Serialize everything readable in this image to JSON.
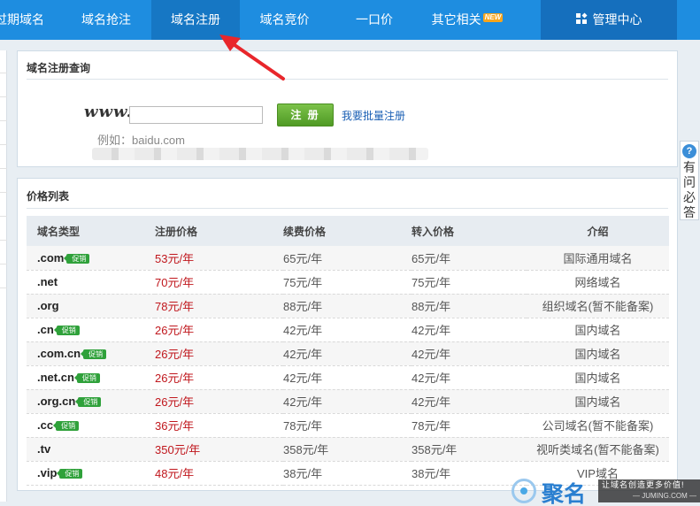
{
  "nav": {
    "items": [
      {
        "label": "过期域名"
      },
      {
        "label": "域名抢注"
      },
      {
        "label": "域名注册"
      },
      {
        "label": "域名竞价"
      },
      {
        "label": "一口价"
      },
      {
        "label": "其它相关",
        "badge": "NEW"
      }
    ],
    "management": "管理中心",
    "active_index": 2
  },
  "query": {
    "title": "域名注册查询",
    "www": "www.",
    "input_value": "",
    "register_button": "注 册",
    "batch_link": "我要批量注册",
    "example": "例如：baidu.com"
  },
  "price_list": {
    "title": "价格列表",
    "headers": [
      "域名类型",
      "注册价格",
      "续费价格",
      "转入价格",
      "介绍"
    ],
    "promo_label": "促销",
    "rows": [
      {
        "ext": ".com",
        "promo": true,
        "reg": "53元/年",
        "renew": "65元/年",
        "transfer": "65元/年",
        "desc": "国际通用域名"
      },
      {
        "ext": ".net",
        "promo": false,
        "reg": "70元/年",
        "renew": "75元/年",
        "transfer": "75元/年",
        "desc": "网络域名"
      },
      {
        "ext": ".org",
        "promo": false,
        "reg": "78元/年",
        "renew": "88元/年",
        "transfer": "88元/年",
        "desc": "组织域名(暂不能备案)"
      },
      {
        "ext": ".cn",
        "promo": true,
        "reg": "26元/年",
        "renew": "42元/年",
        "transfer": "42元/年",
        "desc": "国内域名"
      },
      {
        "ext": ".com.cn",
        "promo": true,
        "reg": "26元/年",
        "renew": "42元/年",
        "transfer": "42元/年",
        "desc": "国内域名"
      },
      {
        "ext": ".net.cn",
        "promo": true,
        "reg": "26元/年",
        "renew": "42元/年",
        "transfer": "42元/年",
        "desc": "国内域名"
      },
      {
        "ext": ".org.cn",
        "promo": true,
        "reg": "26元/年",
        "renew": "42元/年",
        "transfer": "42元/年",
        "desc": "国内域名"
      },
      {
        "ext": ".cc",
        "promo": true,
        "reg": "36元/年",
        "renew": "78元/年",
        "transfer": "78元/年",
        "desc": "公司域名(暂不能备案)"
      },
      {
        "ext": ".tv",
        "promo": false,
        "reg": "350元/年",
        "renew": "358元/年",
        "transfer": "358元/年",
        "desc": "视听类域名(暂不能备案)"
      },
      {
        "ext": ".vip",
        "promo": true,
        "reg": "48元/年",
        "renew": "38元/年",
        "transfer": "38元/年",
        "desc": "VIP域名"
      }
    ]
  },
  "side_tab": {
    "label": "有问必答",
    "icon": "question-bubble-icon"
  },
  "watermark": {
    "name": "聚名",
    "slogan": "让域名创造更多价值!",
    "domain": "— JUMING.COM —"
  },
  "colors": {
    "nav_bg": "#1e8de0",
    "nav_active": "#1677c4",
    "price_red": "#c0171d",
    "promo_green": "#2fa13a",
    "button_green": "#5aa62d",
    "arrow_red": "#e8262b"
  }
}
